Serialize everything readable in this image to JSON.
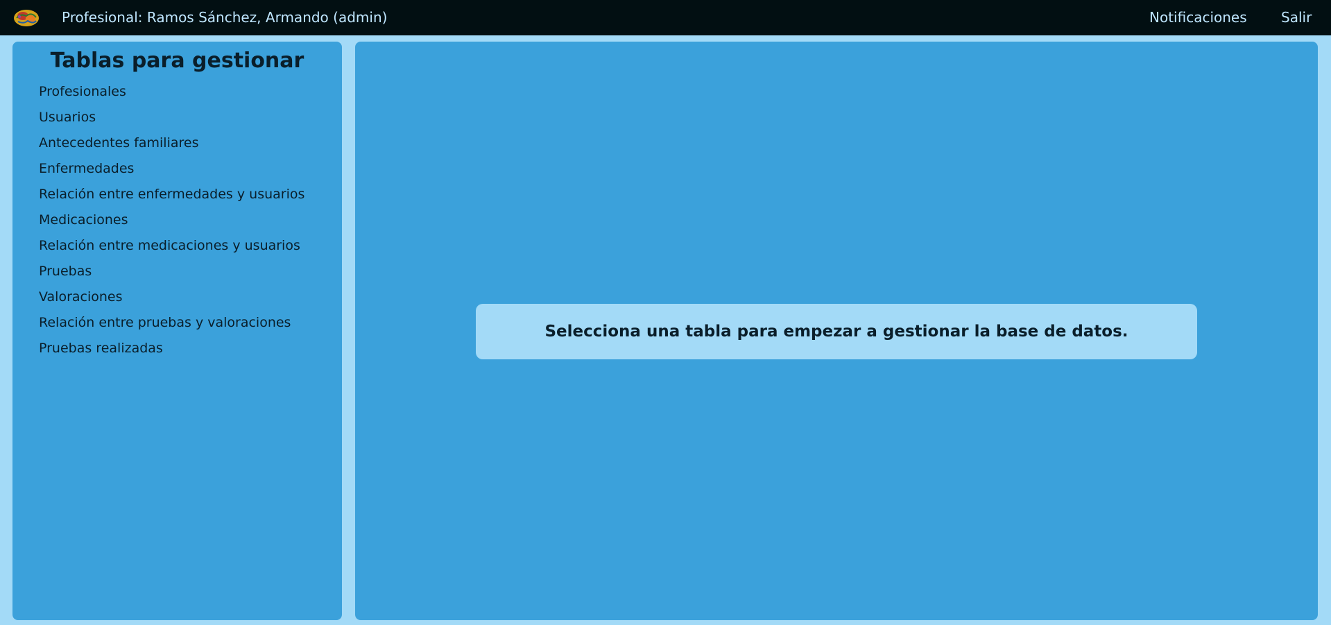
{
  "header": {
    "logo_icon": "brain-icon",
    "title": "Profesional: Ramos Sánchez, Armando (admin)",
    "nav": {
      "notifications": "Notificaciones",
      "logout": "Salir"
    }
  },
  "sidebar": {
    "title": "Tablas para gestionar",
    "items": [
      {
        "label": "Profesionales"
      },
      {
        "label": "Usuarios"
      },
      {
        "label": "Antecedentes familiares"
      },
      {
        "label": "Enfermedades"
      },
      {
        "label": "Relación entre enfermedades y usuarios"
      },
      {
        "label": "Medicaciones"
      },
      {
        "label": "Relación entre medicaciones y usuarios"
      },
      {
        "label": "Pruebas"
      },
      {
        "label": "Valoraciones"
      },
      {
        "label": "Relación entre pruebas y valoraciones"
      },
      {
        "label": "Pruebas realizadas"
      }
    ]
  },
  "main": {
    "message": "Selecciona una tabla para empezar a gestionar la base de datos."
  },
  "colors": {
    "page_background": "#a3daf7",
    "topbar": "#020f12",
    "panel": "#3ba1db",
    "text_dark": "#0a1e2a",
    "text_light": "#bfe6ff"
  }
}
